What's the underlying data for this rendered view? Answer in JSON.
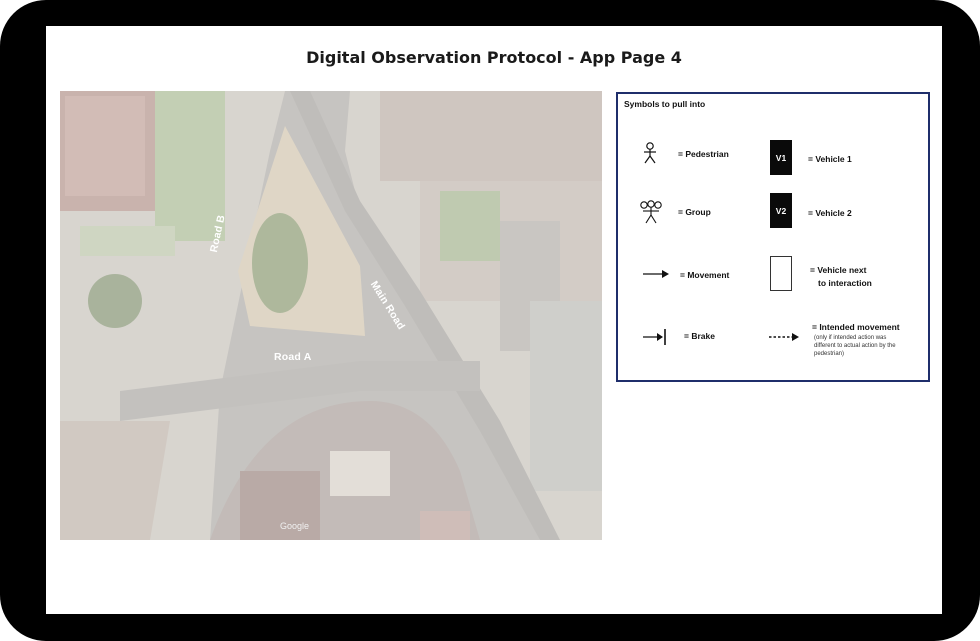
{
  "page": {
    "title": "Digital Observation Protocol - App Page 4"
  },
  "map": {
    "road_b": "Road B",
    "main_road": "Main Road",
    "road_a": "Road A",
    "attribution": "Google"
  },
  "legend": {
    "title": "Symbols to pull into",
    "items": [
      {
        "icon": "pedestrian-icon",
        "label": "= Pedestrian"
      },
      {
        "icon": "group-icon",
        "label": "= Group"
      },
      {
        "icon": "movement-arrow-icon",
        "label": "= Movement"
      },
      {
        "icon": "brake-icon",
        "label": "= Brake"
      },
      {
        "icon": "vehicle-1-icon",
        "box_text": "V1",
        "label": "= Vehicle 1"
      },
      {
        "icon": "vehicle-2-icon",
        "box_text": "V2",
        "label": "= Vehicle 2"
      },
      {
        "icon": "vehicle-next-icon",
        "label_line1": "= Vehicle next",
        "label_line2": "to interaction"
      },
      {
        "icon": "intended-movement-icon",
        "label": "= Intended movement",
        "note_line1": "(only if intended action was",
        "note_line2": "different to actual action by the",
        "note_line3": "pedestrian)"
      }
    ]
  }
}
